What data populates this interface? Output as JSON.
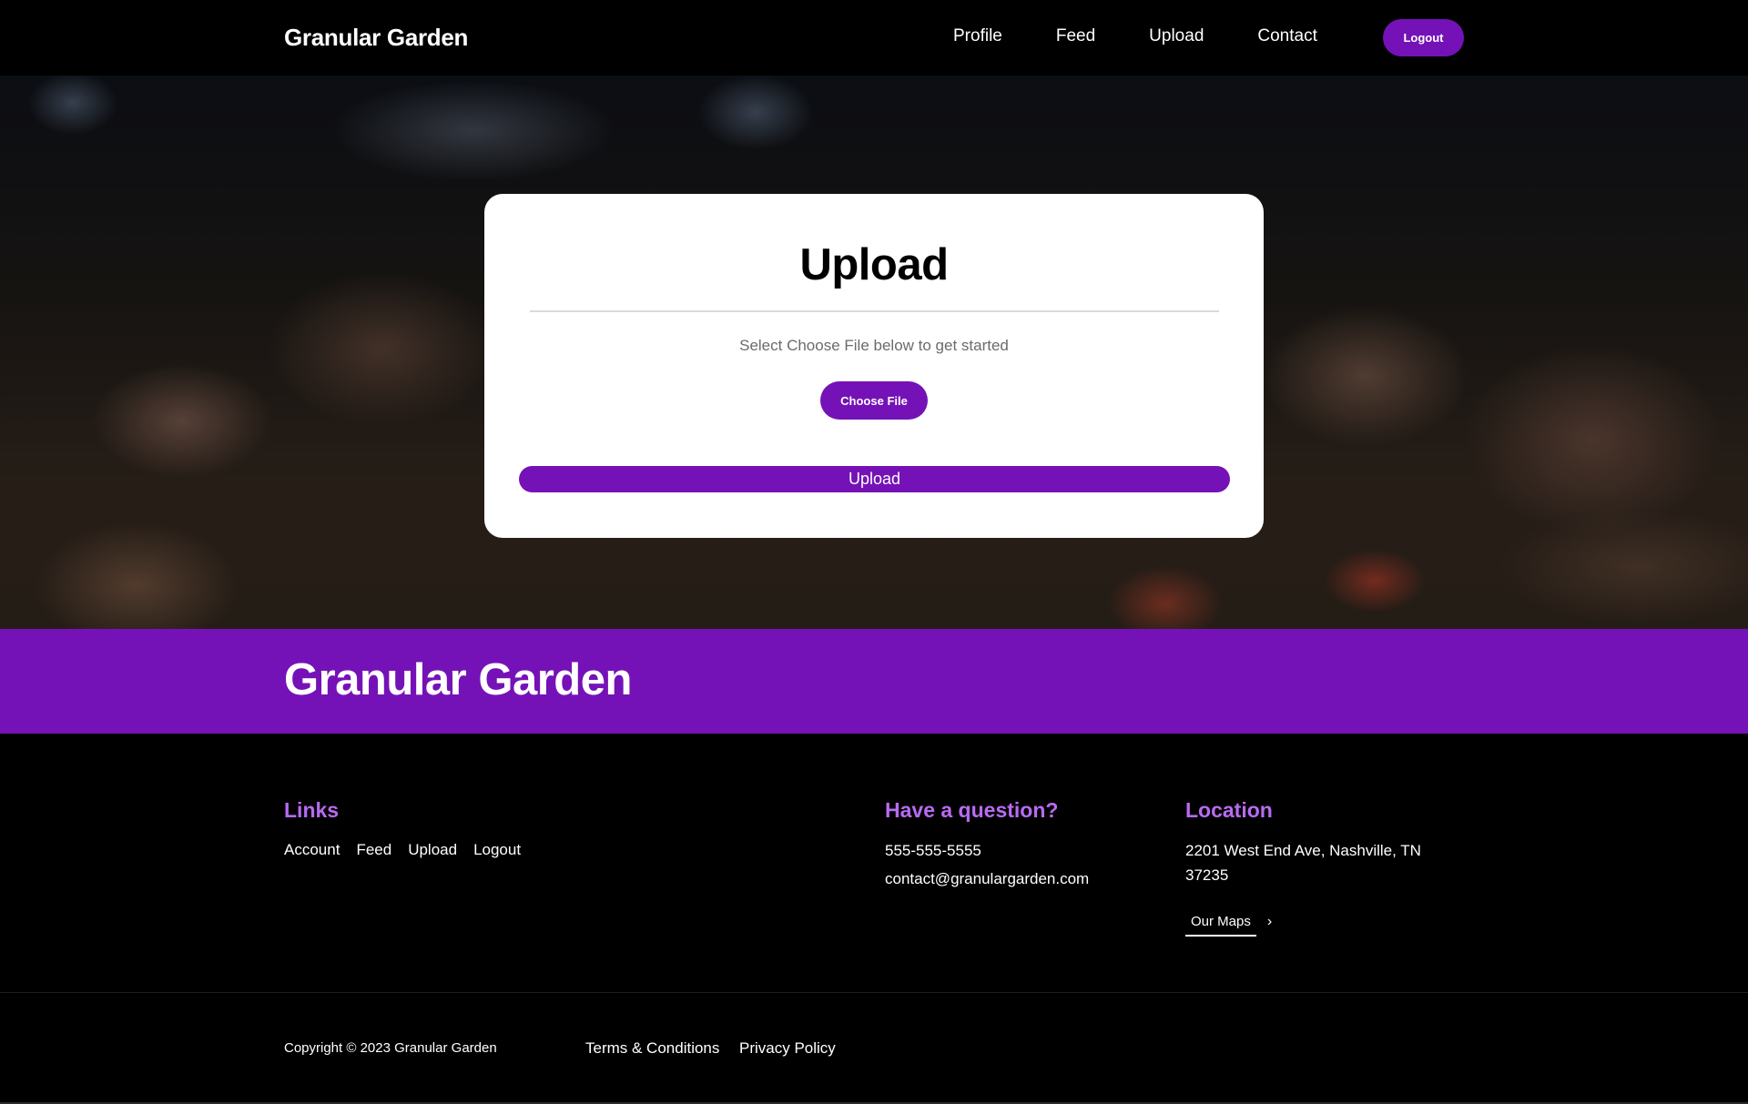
{
  "header": {
    "brand": "Granular Garden",
    "nav": [
      "Profile",
      "Feed",
      "Upload",
      "Contact"
    ],
    "logout_label": "Logout"
  },
  "upload_card": {
    "title": "Upload",
    "subtitle": "Select Choose File below to get started",
    "choose_file_label": "Choose File",
    "upload_label": "Upload"
  },
  "band": {
    "title": "Granular Garden"
  },
  "footer": {
    "links_heading": "Links",
    "links": [
      "Account",
      "Feed",
      "Upload",
      "Logout"
    ],
    "question_heading": "Have a question?",
    "phone": "555-555-5555",
    "email": "contact@granulargarden.com",
    "location_heading": "Location",
    "address": "2201 West End Ave, Nashville, TN 37235",
    "maps_label": "Our Maps",
    "copyright": "Copyright © 2023 Granular Garden",
    "terms": "Terms & Conditions",
    "privacy": "Privacy Policy"
  },
  "colors": {
    "accent": "#7512b7",
    "footer_heading": "#b86bf2",
    "background": "#000000"
  },
  "icons": {
    "maps_arrow": "chevron-right-icon"
  }
}
